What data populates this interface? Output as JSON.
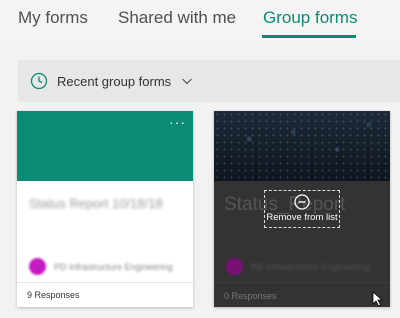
{
  "tabs": [
    {
      "label": "My forms"
    },
    {
      "label": "Shared with me"
    },
    {
      "label": "Group forms",
      "active": true
    }
  ],
  "filter": {
    "label": "Recent group forms",
    "icon": "clock-icon",
    "chevron": "chevron-down-icon"
  },
  "colors": {
    "accent": "#0b8a74",
    "owner_avatar": "#c41cc1"
  },
  "cards": [
    {
      "title": "Status Report 10/18/18",
      "owner": "PD Infrastructure Engineering",
      "responses": "9 Responses",
      "more": "···"
    },
    {
      "title": "Status_Report",
      "owner": "PD Infrastructure Engineering",
      "responses": "0 Responses",
      "remove_label": "Remove from list"
    }
  ]
}
